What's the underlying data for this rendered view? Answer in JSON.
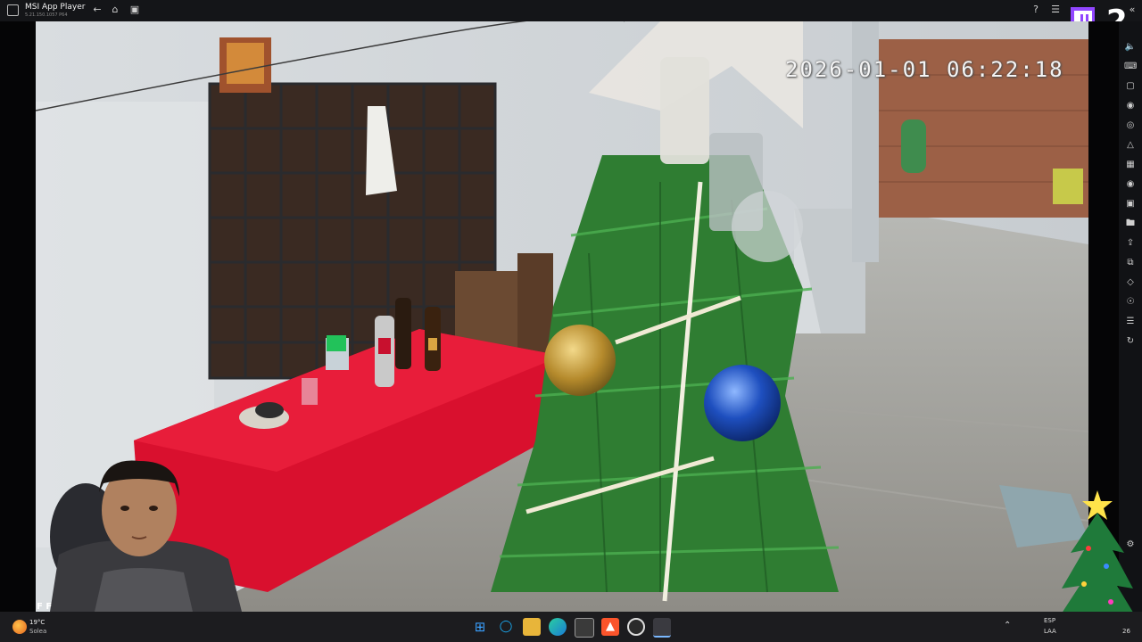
{
  "window": {
    "app_title": "MSI App Player",
    "version": "5.21.150.1057 P64"
  },
  "overlay": {
    "viewer_count": "2",
    "bottom_left_text": "F F"
  },
  "camera": {
    "timestamp": "2026-01-01  06:22:18"
  },
  "taskbar": {
    "weather_temp": "19°C",
    "weather_condition": "Solea",
    "language_top": "ESP",
    "language_bottom": "LAA",
    "clock_fragment": "26",
    "apps": [
      "windows-start",
      "cortana",
      "file-explorer",
      "edge",
      "store",
      "brave",
      "obs",
      "app-player"
    ]
  },
  "colors": {
    "tablecloth": "#d9102e",
    "tree_green": "#2f7d32",
    "twitch_purple": "#9146ff"
  }
}
